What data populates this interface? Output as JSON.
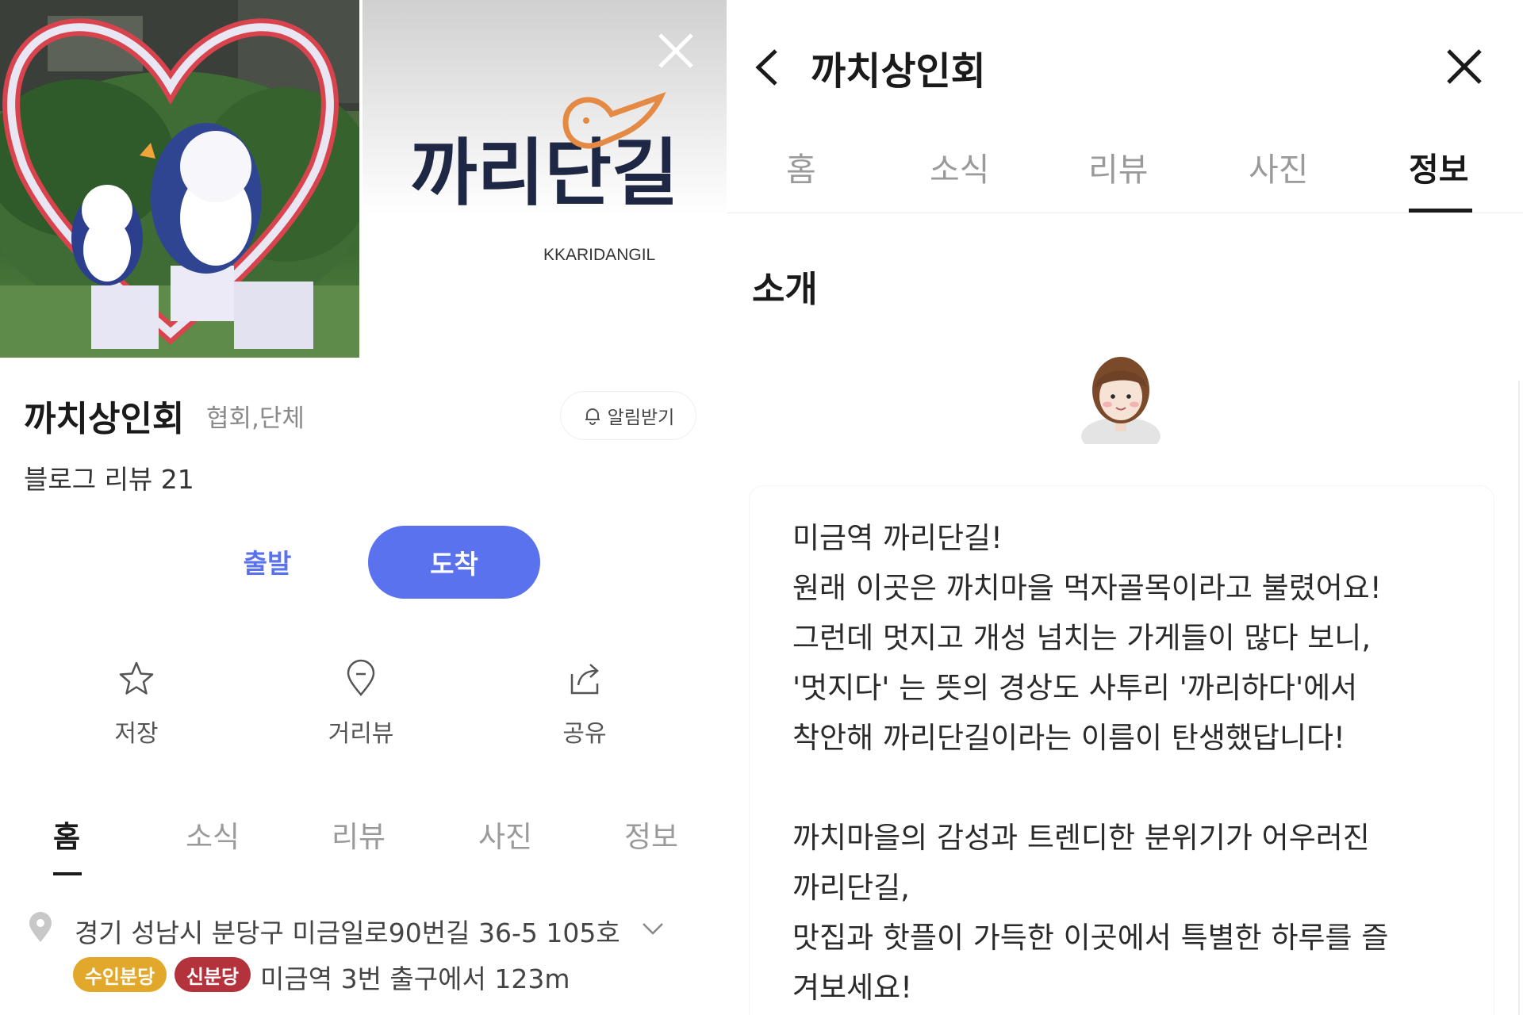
{
  "left": {
    "logo": {
      "wordmark": "까리단길",
      "latin": "KKARIDANGIL"
    },
    "place": {
      "name": "까치상인회",
      "category": "협회,단체",
      "blog_review": "블로그 리뷰 21",
      "alarm_label": "알림받기"
    },
    "route": {
      "depart": "출발",
      "arrive": "도착"
    },
    "actions": [
      {
        "label": "저장",
        "icon": "star-icon"
      },
      {
        "label": "거리뷰",
        "icon": "location-pin-icon"
      },
      {
        "label": "공유",
        "icon": "share-icon"
      }
    ],
    "tabs": [
      "홈",
      "소식",
      "리뷰",
      "사진",
      "정보"
    ],
    "active_tab": "홈",
    "address": "경기 성남시 분당구 미금일로90번길 36-5 105호",
    "subway": {
      "badges": [
        "수인분당",
        "신분당"
      ],
      "exit_text": "미금역 3번 출구에서 123m"
    },
    "colors": {
      "accent": "#5a72ee",
      "badge_suin": "#e2a82c",
      "badge_sin": "#b3323c"
    }
  },
  "right": {
    "title": "까치상인회",
    "tabs": [
      "홈",
      "소식",
      "리뷰",
      "사진",
      "정보"
    ],
    "active_tab": "정보",
    "intro_heading": "소개",
    "intro_lines": [
      "미금역 까리단길!",
      "원래 이곳은 까치마을 먹자골목이라고 불렸어요!",
      "그런데 멋지고 개성 넘치는 가게들이 많다 보니,",
      "'멋지다' 는 뜻의 경상도 사투리 '까리하다'에서",
      "착안해 까리단길이라는 이름이 탄생했답니다!",
      "",
      "까치마을의 감성과 트렌디한 분위기가 어우러진",
      "까리단길,",
      "맛집과 핫플이 가득한 이곳에서 특별한 하루를 즐",
      "겨보세요!"
    ]
  }
}
